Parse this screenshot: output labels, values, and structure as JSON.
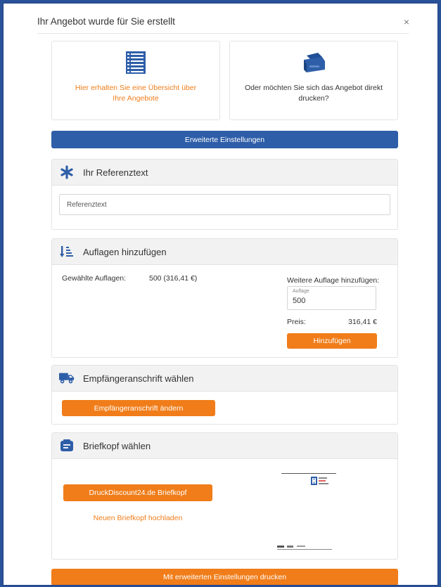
{
  "modal": {
    "title": "Ihr Angebot wurde für Sie erstellt",
    "close_label": "×"
  },
  "cards": {
    "overview_text": "Hier erhalten Sie eine Übersicht über Ihre Angebote",
    "print_text": "Oder möchten Sie sich das Angebot direkt drucken?"
  },
  "advanced_button": "Erweiterte Einstellungen",
  "reference": {
    "heading": "Ihr Referenztext",
    "placeholder": "Referenztext"
  },
  "auflagen": {
    "heading": "Auflagen hinzufügen",
    "selected_label": "Gewählte Auflagen:",
    "selected_value": "500 (316,41 €)",
    "add_label": "Weitere Auflage hinzufügen:",
    "field_label": "Auflage",
    "field_value": "500",
    "price_label": "Preis:",
    "price_value": "316,41 €",
    "add_button": "Hinzufügen"
  },
  "empfaenger": {
    "heading": "Empfängeranschrift wählen",
    "button": "Empfängeranschrift ändern"
  },
  "briefkopf": {
    "heading": "Briefkopf wählen",
    "druck_button": "DruckDiscount24.de Briefkopf",
    "upload_link": "Neuen Briefkopf hochladen"
  },
  "final_button": "Mit erweiterten Einstellungen drucken",
  "colors": {
    "primary_blue": "#2e5ea8",
    "accent_orange": "#f07d1a",
    "page_bg": "#2a5298"
  },
  "icons": {
    "overview": "list-icon",
    "print": "printer-icon",
    "reference": "asterisk-icon",
    "auflagen": "sort-amount-icon",
    "empfaenger": "truck-icon",
    "briefkopf": "letter-icon"
  }
}
